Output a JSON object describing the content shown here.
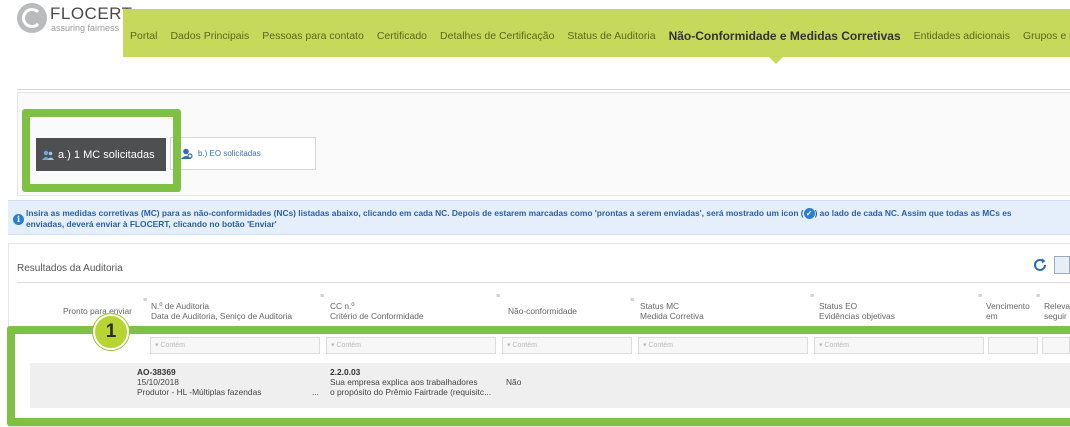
{
  "logo": {
    "name": "FLOCERT",
    "tagline": "assuring fairness"
  },
  "nav": {
    "items": [
      "Portal",
      "Dados Principais",
      "Pessoas para contato",
      "Certificado",
      "Detalhes de Certificação",
      "Status de Auditoria",
      "Não-Conformidade e Medidas Corretivas",
      "Entidades adicionais",
      "Grupos e res"
    ],
    "active_index": 6
  },
  "filters": {
    "a_label": "a.) 1 MC solicitadas",
    "b_label": "b.) EO solicitadas"
  },
  "info": {
    "line1_before_icon": "Insira as medidas corretivas (MC) para as não-conformidades (NCs) listadas abaixo, clicando em cada NC. Depois de estarem marcadas como 'prontas a serem enviadas', será mostrado um icon (",
    "line1_after_icon": ") ao lado de cada NC. Assim que todas as MCs es",
    "line2": "enviadas, deverá enviar à FLOCERT, clicando no botão 'Enviar'"
  },
  "results": {
    "title": "Resultados da Auditoria",
    "columns": {
      "ready": "Pronto para enviar",
      "audit_no": "N.º de Auditoria",
      "audit_date": "Data de Auditoria, Seniço de Auditoria",
      "cc_no": "CC n.º",
      "criterion": "Critério de Conformidade",
      "nc": "Não-conformidade",
      "mc_status": "Status MC",
      "mc_measure": "Medida Corretiva",
      "eo_status": "Status EO",
      "eo_evidence": "Evidências objetivas",
      "due1": "Vencimento",
      "due2": "em",
      "rel1": "Releva",
      "rel2": "seguir"
    },
    "filter_placeholder": "Contém",
    "rows": [
      {
        "audit_no": "AO-38369",
        "date": "15/10/2018",
        "service": "Produtor - HL -Múltiplas fazendas",
        "ellipsis": "...",
        "cc": "2.2.0.03",
        "criterion_1": "Sua empresa explica aos trabalhadores",
        "criterion_2": "o propósito do Prêmio Fairtrade (requisitc...",
        "nc": "Não"
      }
    ]
  },
  "badge": "1",
  "colors": {
    "nav_bg": "#c7d95a",
    "highlight": "#7ec144",
    "info_bg": "#e4effb",
    "info_text": "#2b5fa3",
    "filter_active_bg": "#4d4f51"
  }
}
